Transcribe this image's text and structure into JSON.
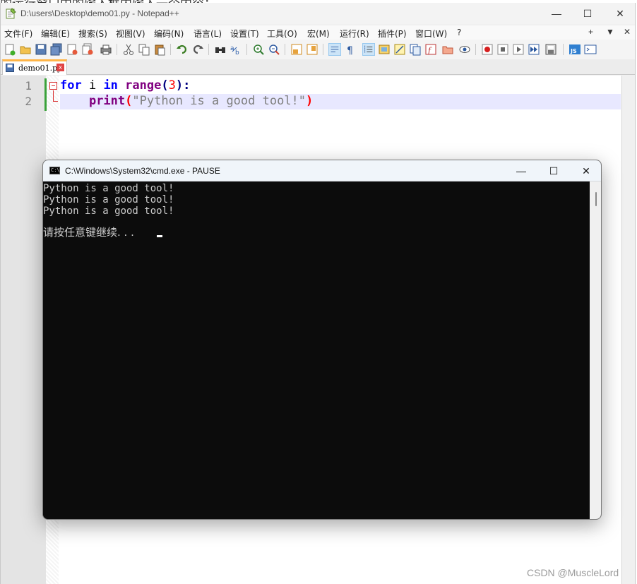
{
  "top_cut_text": "的运行窗口中的输入框内输入一个内容：",
  "window": {
    "title": "D:\\users\\Desktop\\demo01.py - Notepad++",
    "minimize": "—",
    "maximize": "☐",
    "close": "✕"
  },
  "menu": {
    "items": [
      "文件(F)",
      "编辑(E)",
      "搜索(S)",
      "视图(V)",
      "编码(N)",
      "语言(L)",
      "设置(T)",
      "工具(O)",
      "宏(M)",
      "运行(R)",
      "插件(P)",
      "窗口(W)",
      "?"
    ],
    "controls": [
      "+",
      "▼",
      "✕"
    ]
  },
  "tab": {
    "label": "demo01.py",
    "close": "x"
  },
  "editor": {
    "line_numbers": [
      "1",
      "2"
    ],
    "line1": {
      "kw_for": "for",
      "var": " i ",
      "kw_in": "in",
      "sp": " ",
      "fn": "range",
      "open": "(",
      "num": "3",
      "close": ")",
      "colon": ":"
    },
    "line2": {
      "indent": "    ",
      "fn": "print",
      "open": "(",
      "str": "\"Python is a good tool!\"",
      "close": ")"
    }
  },
  "cmd": {
    "title": "C:\\Windows\\System32\\cmd.exe - PAUSE",
    "icon_text": "C:\\",
    "minimize": "—",
    "maximize": "☐",
    "close": "✕",
    "output": [
      "Python is a good tool!",
      "Python is a good tool!",
      "Python is a good tool!",
      "",
      "请按任意键继续. . ."
    ]
  },
  "watermark": "CSDN @MuscleLord"
}
